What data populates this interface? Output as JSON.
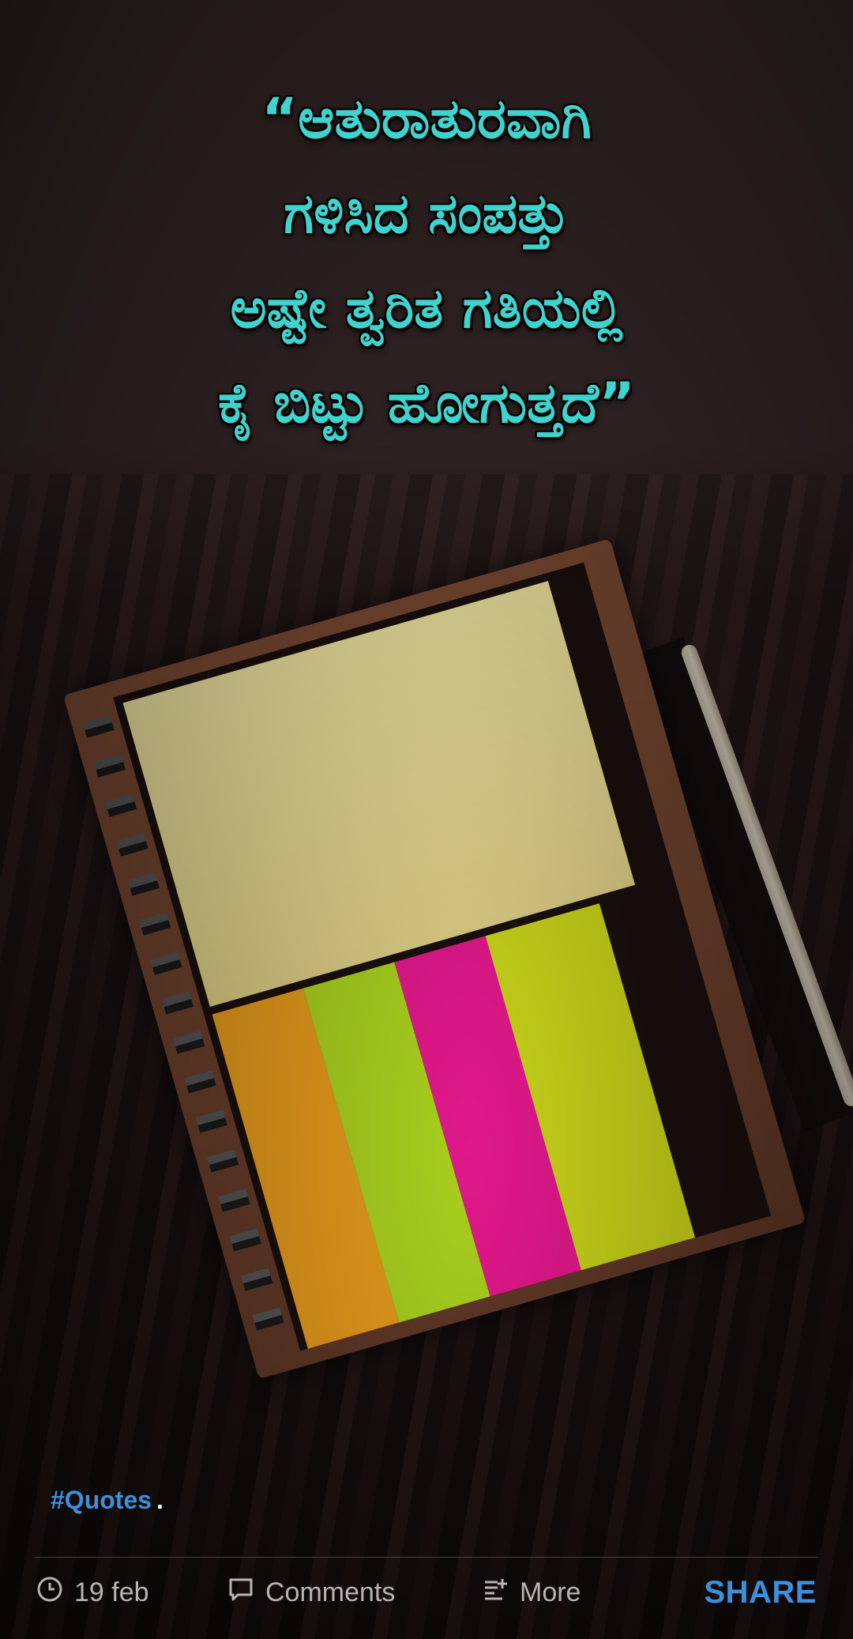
{
  "quote": {
    "lines": [
      "“ಆತುರಾತುರವಾಗಿ",
      "ಗಳಿಸಿದ ಸಂಪತ್ತು",
      "ಅಷ್ಟೇ ತ್ವರಿತ ಗತಿಯಲ್ಲಿ",
      "ಕೈ ಬಿಟ್ಟು ಹೋಗುತ್ತದೆ”"
    ],
    "color": "#3fd3ce"
  },
  "post": {
    "hashtag": "#Quotes",
    "hashtag_suffix": ".",
    "accent_color": "#3d8fdc"
  },
  "actions": {
    "date_label": "19 feb",
    "comments_label": "Comments",
    "more_label": "More",
    "share_label": "SHARE"
  },
  "icons": {
    "date": "clock-icon",
    "comments": "comment-icon",
    "more": "more-icon"
  }
}
